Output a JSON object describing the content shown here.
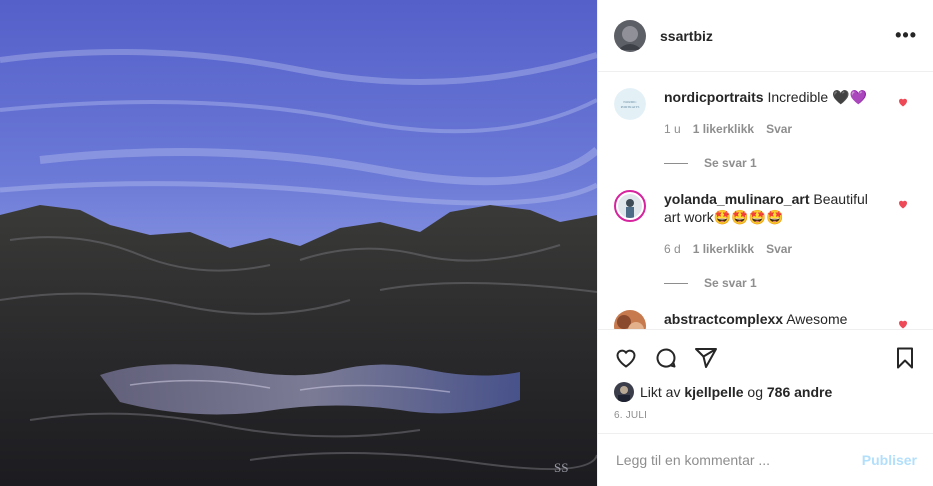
{
  "post": {
    "username": "ssartbiz",
    "more_label": "•••",
    "image_signature": "SS"
  },
  "comments": [
    {
      "user": "nordicportraits",
      "text": "Incredible 🖤💜",
      "age": "1 u",
      "likes": "1 likerklikk",
      "reply": "Svar",
      "view_replies": "Se svar 1",
      "avatar_text": "NORDIC PORTRAITS"
    },
    {
      "user": "yolanda_mulinaro_art",
      "text": "Beautiful art work🤩🤩🤩🤩",
      "age": "6 d",
      "likes": "1 likerklikk",
      "reply": "Svar",
      "view_replies": "Se svar 1"
    },
    {
      "user": "abstractcomplexx",
      "text": "Awesome"
    }
  ],
  "likes": {
    "prefix": "Likt av",
    "user": "kjellpelle",
    "joiner": "og",
    "others": "786 andre"
  },
  "date": "6. JULI",
  "add_comment": {
    "placeholder": "Legg til en kommentar ...",
    "post_label": "Publiser"
  },
  "colors": {
    "like_red": "#ed4956",
    "post_button_disabled": "#b2dffc",
    "meta_gray": "#8e8e8e"
  },
  "icons": [
    "heart-icon",
    "comment-icon",
    "share-icon",
    "bookmark-icon",
    "more-options-icon"
  ]
}
